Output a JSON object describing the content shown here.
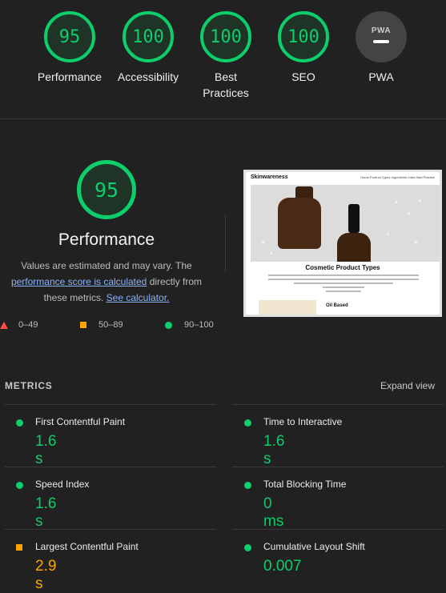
{
  "gauges": [
    {
      "score": "95",
      "label": "Performance"
    },
    {
      "score": "100",
      "label": "Accessibility"
    },
    {
      "score": "100",
      "label": "Best Practices"
    },
    {
      "score": "100",
      "label": "SEO"
    },
    {
      "score": "",
      "label": "PWA",
      "badge": "PWA"
    }
  ],
  "performance": {
    "score": "95",
    "title": "Performance",
    "desc_part1": "Values are estimated and may vary. The",
    "desc_link1": "performance score is calculated",
    "desc_part2": "directly from",
    "desc_part3": "these metrics.",
    "desc_link2": "See calculator."
  },
  "legend": {
    "fail": "0–49",
    "average": "50–89",
    "pass": "90–100"
  },
  "screenshot": {
    "brand": "Skinwareness",
    "nav": "Home  Product Types  Ingredients Index  Bad Practice",
    "heading": "Cosmetic Product Types",
    "subheading": "Oil Based"
  },
  "metrics": {
    "heading": "METRICS",
    "expand_label": "Expand view",
    "items": [
      {
        "label": "First Contentful Paint",
        "value": "1.6 s",
        "status": "pass"
      },
      {
        "label": "Time to Interactive",
        "value": "1.6 s",
        "status": "pass"
      },
      {
        "label": "Speed Index",
        "value": "1.6 s",
        "status": "pass"
      },
      {
        "label": "Total Blocking Time",
        "value": "0 ms",
        "status": "pass"
      },
      {
        "label": "Largest Contentful Paint",
        "value": "2.9 s",
        "status": "average"
      },
      {
        "label": "Cumulative Layout Shift",
        "value": "0.007",
        "status": "pass"
      }
    ]
  },
  "colors": {
    "pass": "#0cce6b",
    "average": "#ffa400",
    "fail": "#ff4e42",
    "background": "#212121"
  }
}
